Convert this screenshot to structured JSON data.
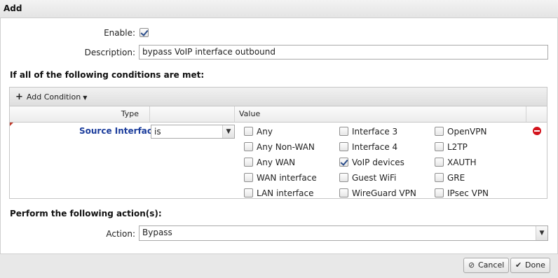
{
  "dialog": {
    "title": "Add"
  },
  "form": {
    "enable_label": "Enable:",
    "enable_checked": true,
    "description_label": "Description:",
    "description_value": "bypass VoIP interface outbound"
  },
  "conditions": {
    "heading": "If all of the following conditions are met:",
    "add_condition_label": "Add Condition",
    "columns": {
      "type": "Type",
      "value": "Value"
    },
    "row": {
      "type_label": "Source Interface:",
      "operator": "is",
      "options_col1": [
        {
          "label": "Any",
          "checked": false
        },
        {
          "label": "Any Non-WAN",
          "checked": false
        },
        {
          "label": "Any WAN",
          "checked": false
        },
        {
          "label": "WAN interface",
          "checked": false
        },
        {
          "label": "LAN interface",
          "checked": false
        }
      ],
      "options_col2": [
        {
          "label": "Interface 3",
          "checked": false
        },
        {
          "label": "Interface 4",
          "checked": false
        },
        {
          "label": "VoIP devices",
          "checked": true
        },
        {
          "label": "Guest WiFi",
          "checked": false
        },
        {
          "label": "WireGuard VPN",
          "checked": false
        }
      ],
      "options_col3": [
        {
          "label": "OpenVPN",
          "checked": false
        },
        {
          "label": "L2TP",
          "checked": false
        },
        {
          "label": "XAUTH",
          "checked": false
        },
        {
          "label": "GRE",
          "checked": false
        },
        {
          "label": "IPsec VPN",
          "checked": false
        }
      ]
    }
  },
  "actions": {
    "heading": "Perform the following action(s):",
    "action_label": "Action:",
    "action_value": "Bypass"
  },
  "footer": {
    "cancel_label": "Cancel",
    "done_label": "Done"
  },
  "colors": {
    "accent_link": "#1c3d9c",
    "remove": "#d3131c",
    "row_marker": "#c0392b"
  }
}
